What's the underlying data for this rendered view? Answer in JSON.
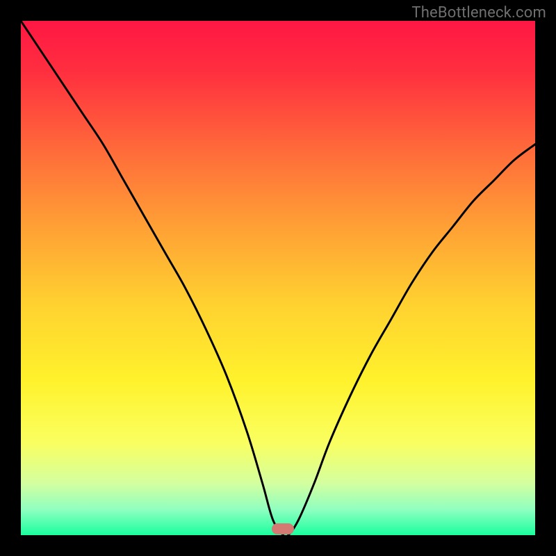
{
  "watermark": "TheBottleneck.com",
  "chart_data": {
    "type": "line",
    "title": "",
    "xlabel": "",
    "ylabel": "",
    "xlim": [
      0,
      100
    ],
    "ylim": [
      0,
      100
    ],
    "series": [
      {
        "name": "bottleneck-curve",
        "x": [
          0,
          4,
          8,
          12,
          16,
          20,
          24,
          28,
          32,
          36,
          40,
          44,
          47,
          49,
          51,
          52,
          54,
          57,
          60,
          64,
          68,
          72,
          76,
          80,
          84,
          88,
          92,
          96,
          100
        ],
        "values": [
          100,
          94,
          88,
          82,
          76,
          69,
          62,
          55,
          48,
          40,
          31,
          20,
          10,
          3,
          0,
          0,
          3,
          10,
          18,
          27,
          35,
          42,
          49,
          55,
          60,
          65,
          69,
          73,
          76
        ]
      }
    ],
    "gradient_stops": [
      {
        "offset": 0.0,
        "color": "#ff1744"
      },
      {
        "offset": 0.1,
        "color": "#ff2f3f"
      },
      {
        "offset": 0.25,
        "color": "#ff6a3a"
      },
      {
        "offset": 0.4,
        "color": "#ffa035"
      },
      {
        "offset": 0.55,
        "color": "#ffd130"
      },
      {
        "offset": 0.7,
        "color": "#fff22c"
      },
      {
        "offset": 0.82,
        "color": "#faff60"
      },
      {
        "offset": 0.9,
        "color": "#d3ffa0"
      },
      {
        "offset": 0.95,
        "color": "#8fffc0"
      },
      {
        "offset": 1.0,
        "color": "#1aff9e"
      }
    ],
    "annotations": [
      {
        "name": "optimal-marker",
        "x": 51,
        "y": 1.2,
        "color": "#d47a72"
      }
    ]
  },
  "plot_geometry": {
    "outer_size": 800,
    "inner_left": 30,
    "inner_top": 30,
    "inner_width": 740,
    "inner_height": 740
  }
}
